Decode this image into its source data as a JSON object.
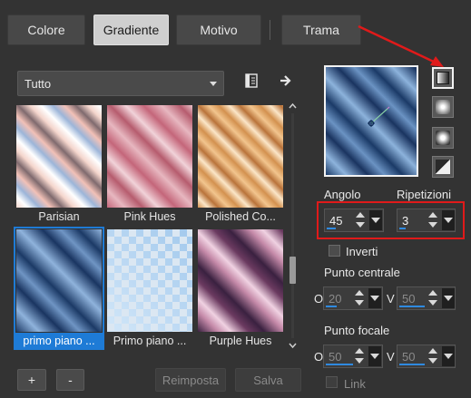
{
  "tabs": [
    {
      "label": "Colore",
      "active": false
    },
    {
      "label": "Gradiente",
      "active": true
    },
    {
      "label": "Motivo",
      "active": false
    },
    {
      "label": "Trama",
      "active": false
    }
  ],
  "library": {
    "dropdown_value": "Tutto",
    "icons": [
      "library-manager-icon",
      "arrow-right-icon"
    ],
    "items": [
      {
        "label": "Parisian",
        "selected": false
      },
      {
        "label": "Pink Hues",
        "selected": false
      },
      {
        "label": "Polished Co...",
        "selected": false
      },
      {
        "label": "primo piano ...",
        "selected": true
      },
      {
        "label": "Primo piano ...",
        "selected": false
      },
      {
        "label": "Purple Hues",
        "selected": false
      }
    ],
    "add_label": "+",
    "remove_label": "-",
    "reset_label": "Reimposta",
    "save_label": "Salva"
  },
  "settings": {
    "angle_label": "Angolo",
    "angle_value": "45",
    "repeat_label": "Ripetizioni",
    "repeat_value": "3",
    "invert_label": "Inverti",
    "center_label": "Punto centrale",
    "center_h": "20",
    "center_v": "50",
    "focal_label": "Punto focale",
    "focal_h": "50",
    "focal_v": "50",
    "h_label": "O",
    "v_label": "V",
    "link_label": "Link"
  },
  "colors": {
    "accent": "#1e7bd6",
    "highlight_box": "#e01a1a",
    "arrow": "#e01a1a"
  }
}
